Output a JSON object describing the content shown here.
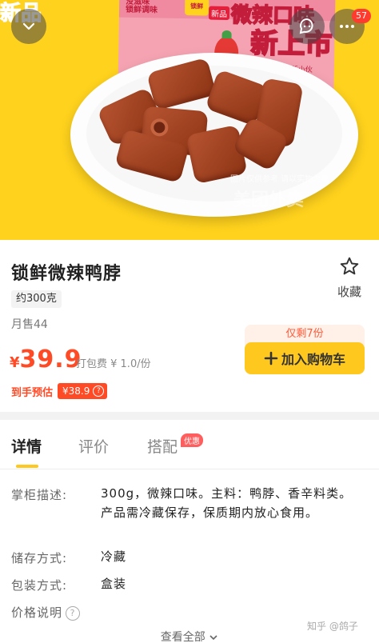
{
  "hero": {
    "package_side_text": "新品",
    "package_brand": "没滋味",
    "package_brand_sub": "锁鲜调味",
    "package_logo": "锁鲜",
    "package_new_tag": "新品",
    "package_headline": "微辣口味",
    "package_headline2": "新上市",
    "package_sub": "微辣新小伙",
    "watermark_small": "图片仅供参考 请以实物为准",
    "watermark_big": "美团外卖",
    "message_badge": "57"
  },
  "product": {
    "title": "锁鲜微辣鸭脖",
    "spec": "约300克",
    "monthly_sales": "月售44",
    "favorite_label": "收藏",
    "price_currency": "¥",
    "price_value": "39.9",
    "packing_fee": "打包费 ¥ 1.0/份",
    "estimate_label": "到手预估",
    "estimate_price": "¥38.9",
    "stock_tag": "仅剩7份",
    "add_to_cart": "加入购物车"
  },
  "details": {
    "tabs": [
      {
        "label": "详情"
      },
      {
        "label": "评价"
      },
      {
        "label": "搭配"
      }
    ],
    "promo_badge": "优惠",
    "rows": [
      {
        "label": "掌柜描述:",
        "value": "300g，微辣口味。主料：鸭脖、香辛料类。产品需冷藏保存，保质期内放心食用。"
      },
      {
        "label": "储存方式:",
        "value": "冷藏"
      },
      {
        "label": "包装方式:",
        "value": "盒装"
      },
      {
        "label": "价格说明"
      }
    ],
    "view_all": "查看全部",
    "source_watermark": "知乎 @鸽子"
  },
  "colors": {
    "accent_yellow": "#ffc81e",
    "price_red": "#ff4a26"
  },
  "icons": [
    "chevron-down-icon",
    "chat-icon",
    "more-icon",
    "star-icon",
    "plus-icon",
    "question-icon",
    "chevron-down-small-icon"
  ]
}
